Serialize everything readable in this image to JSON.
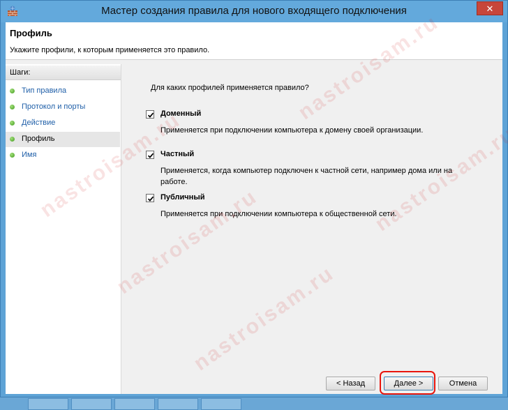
{
  "window": {
    "title": "Мастер создания правила для нового входящего подключения",
    "close_label": "✕"
  },
  "header": {
    "title": "Профиль",
    "subtitle": "Укажите профили, к которым применяется это правило."
  },
  "sidebar": {
    "heading": "Шаги:",
    "steps": [
      {
        "label": "Тип правила",
        "active": false
      },
      {
        "label": "Протокол и порты",
        "active": false
      },
      {
        "label": "Действие",
        "active": false
      },
      {
        "label": "Профиль",
        "active": true
      },
      {
        "label": "Имя",
        "active": false
      }
    ]
  },
  "main": {
    "question": "Для каких профилей применяется правило?",
    "options": [
      {
        "label": "Доменный",
        "checked": true,
        "description": "Применяется при подключении компьютера к домену своей организации."
      },
      {
        "label": "Частный",
        "checked": true,
        "description": "Применяется, когда компьютер подключен к частной сети, например дома или на работе."
      },
      {
        "label": "Публичный",
        "checked": true,
        "description": "Применяется при подключении компьютера к общественной сети."
      }
    ]
  },
  "buttons": {
    "back": "< Назад",
    "next": "Далее >",
    "cancel": "Отмена"
  },
  "watermark": {
    "text": "nastroisam.ru"
  },
  "colors": {
    "accent": "#63a9dc",
    "highlight": "#e8150d",
    "link": "#1f5fa8"
  }
}
